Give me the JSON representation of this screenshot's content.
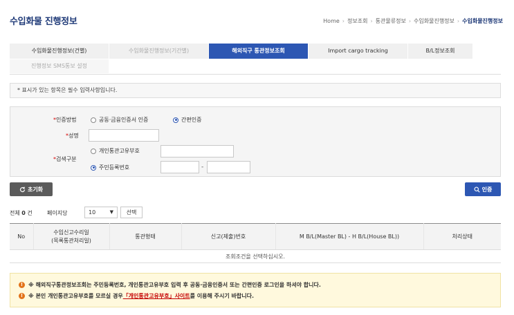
{
  "page": {
    "title": "수입화물 진행정보"
  },
  "breadcrumb": {
    "items": [
      "Home",
      "정보조회",
      "통관물류정보",
      "수입화물진행정보"
    ],
    "current": "수입화물진행정보"
  },
  "tabs": {
    "row1": [
      {
        "label": "수입화물진행정보(건별)",
        "state": "normal"
      },
      {
        "label": "수입화물진행정보(기간별)",
        "state": "disabled"
      },
      {
        "label": "해외직구 통관정보조회",
        "state": "active"
      },
      {
        "label": "Import cargo tracking",
        "state": "normal"
      },
      {
        "label": "B/L정보조회",
        "state": "normal"
      }
    ],
    "row2": [
      {
        "label": "진행정보 SMS통보 설정",
        "state": "disabled"
      }
    ]
  },
  "notice": {
    "text": "* 표시가 있는 항목은 필수 입력사항입니다."
  },
  "form": {
    "auth_method": {
      "label": "인증방법",
      "options": [
        "공동·금융인증서 인증",
        "간편인증"
      ],
      "selected_index": 1
    },
    "name": {
      "label": "성명",
      "value": ""
    },
    "search_type": {
      "label": "검색구분",
      "options": [
        "개인통관고유부호",
        "주민등록번호"
      ],
      "selected_index": 1,
      "customs_code_value": "",
      "rrn_front_value": "",
      "rrn_back_value": "",
      "separator": "-"
    }
  },
  "buttons": {
    "reset": "초기화",
    "authenticate": "인증",
    "select": "선택"
  },
  "results": {
    "total_prefix": "전체",
    "total_count": "0",
    "total_suffix": "건",
    "per_page_label": "페이지당",
    "per_page_value": "10",
    "columns": [
      "No",
      "수입신고수리일\n(목록통관처리일)",
      "통관형태",
      "신고(제출)번호",
      "M B/L(Master BL) - H B/L(House BL))",
      "처리상태"
    ],
    "empty_message": "조회조건을 선택하십시오."
  },
  "warnings": {
    "line1": "※ 해외직구통관정보조회는 주민등록번호, 개인통관고유부호 입력 후 공동·금융인증서 또는 간편인증 로그인을 하셔야 합니다.",
    "line2_prefix": "※ 본인 개인통관고유부호를 모르실 경우 ",
    "line2_link": "「개인통관고유부호」사이트",
    "line2_suffix": "를 이용해 주시기 바랍니다."
  },
  "colors": {
    "brand_blue": "#2d57b3",
    "title_navy": "#1f3a78",
    "required_red": "#d60000",
    "warning_orange": "#e2731a",
    "warning_bg": "#fff9dd"
  },
  "icons": {
    "reset": "refresh-icon",
    "auth": "search-icon",
    "select_caret": "chevron-down-icon",
    "warning": "exclamation-circle-icon"
  }
}
